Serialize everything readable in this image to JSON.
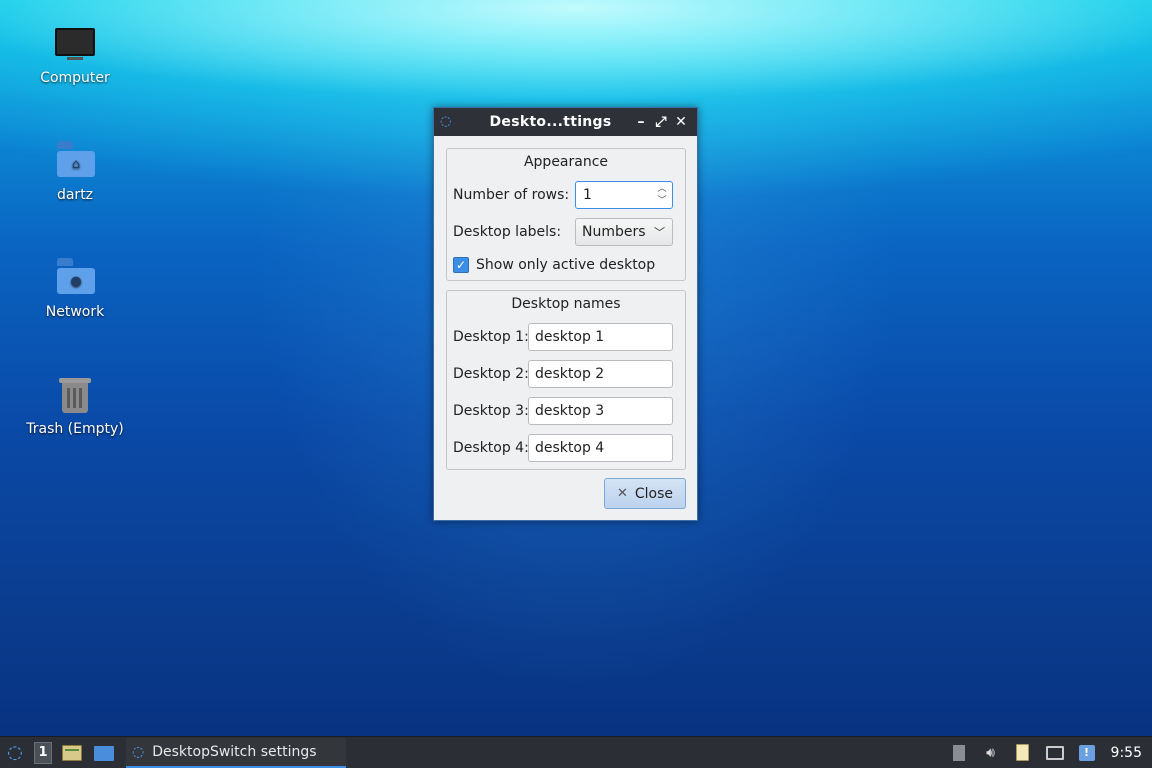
{
  "desktop": {
    "icons": [
      {
        "label": "Computer",
        "icon": "computer-icon"
      },
      {
        "label": "dartz",
        "icon": "home-folder-icon"
      },
      {
        "label": "Network",
        "icon": "network-folder-icon"
      },
      {
        "label": "Trash (Empty)",
        "icon": "trash-icon"
      }
    ]
  },
  "dialog": {
    "title": "Deskto...ttings",
    "appearance": {
      "group_title": "Appearance",
      "rows_label": "Number of rows:",
      "rows_value": "1",
      "labels_label": "Desktop labels:",
      "labels_value": "Numbers",
      "show_active_label": "Show only active desktop",
      "show_active_checked": true
    },
    "names": {
      "group_title": "Desktop names",
      "desktops": [
        {
          "label": "Desktop 1:",
          "value": "desktop 1"
        },
        {
          "label": "Desktop 2:",
          "value": "desktop 2"
        },
        {
          "label": "Desktop 3:",
          "value": "desktop 3"
        },
        {
          "label": "Desktop 4:",
          "value": "desktop 4"
        }
      ]
    },
    "close_label": "Close"
  },
  "taskbar": {
    "desktop_number": "1",
    "task_label": "DesktopSwitch settings",
    "clock": "9:55"
  },
  "colors": {
    "accent": "#3d8ee6",
    "titlebar": "#2e3238",
    "taskbar": "#2b2f35"
  }
}
